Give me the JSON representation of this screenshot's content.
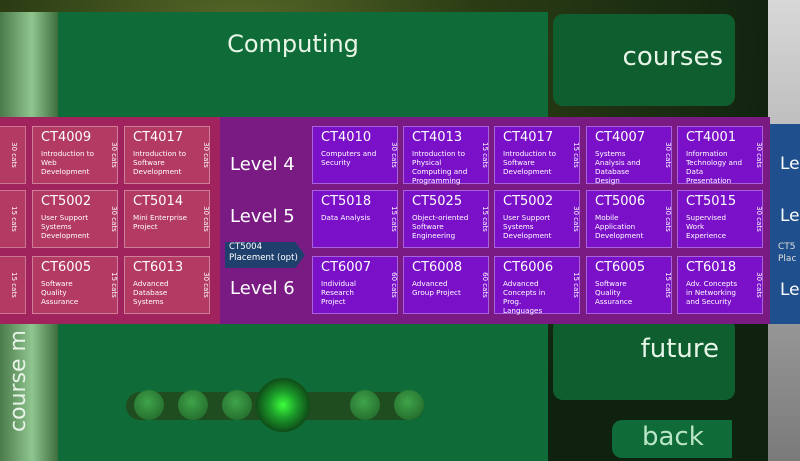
{
  "title": "Computing",
  "side_label": "course m",
  "nav": {
    "courses": "courses",
    "future": "future",
    "back": "back"
  },
  "levels": [
    "Level 4",
    "Level 5",
    "Level 6"
  ],
  "right_peek": {
    "levels": [
      "Le",
      "Le",
      "Le"
    ],
    "placement": [
      "CT5",
      "Plac"
    ]
  },
  "placement": {
    "code": "CT5004",
    "label": "Placement (opt)"
  },
  "left_edge_cats": [
    "30 cats",
    "15 cats",
    "15 cats"
  ],
  "left_modules": [
    [
      {
        "code": "CT4009",
        "name": "Introduction to Web Development",
        "cats": "30 cats"
      },
      {
        "code": "CT4017",
        "name": "Introduction to Software Development",
        "cats": "30 cats"
      }
    ],
    [
      {
        "code": "CT5002",
        "name": "User Support Systems Development",
        "cats": "30 cats"
      },
      {
        "code": "CT5014",
        "name": "Mini Enterprise Project",
        "cats": "30 cats"
      }
    ],
    [
      {
        "code": "CT6005",
        "name": "Software Quality Assurance",
        "cats": "15 cats"
      },
      {
        "code": "CT6013",
        "name": "Advanced Database Systems",
        "cats": "30 cats"
      }
    ]
  ],
  "modules": [
    [
      {
        "code": "CT4010",
        "name": "Computers and Security",
        "cats": "30 cats"
      },
      {
        "code": "CT4013",
        "name": "Introduction to Physical Computing and Programming",
        "cats": "15 cats"
      },
      {
        "code": "CT4017",
        "name": "Introduction to Software Development",
        "cats": "15 cats"
      },
      {
        "code": "CT4007",
        "name": "Systems Analysis and Database Design",
        "cats": "30 cats"
      },
      {
        "code": "CT4001",
        "name": "Information Technology and Data Presentation",
        "cats": "30 cats"
      }
    ],
    [
      {
        "code": "CT5018",
        "name": "Data Analysis",
        "cats": "15 cats"
      },
      {
        "code": "CT5025",
        "name": "Object-oriented Software Engineering",
        "cats": "15 cats"
      },
      {
        "code": "CT5002",
        "name": "User Support Systems Development",
        "cats": "30 cats"
      },
      {
        "code": "CT5006",
        "name": "Mobile Application Development",
        "cats": "30 cats"
      },
      {
        "code": "CT5015",
        "name": "Supervised Work Experience",
        "cats": "30 cats"
      }
    ],
    [
      {
        "code": "CT6007",
        "name": "Individual Research Project",
        "cats": "60 cats"
      },
      {
        "code": "CT6008",
        "name": "Advanced Group Project",
        "cats": "60 cats"
      },
      {
        "code": "CT6006",
        "name": "Advanced Concepts in Prog. Languages",
        "cats": "15 cats"
      },
      {
        "code": "CT6005",
        "name": "Software Quality Assurance",
        "cats": "15 cats"
      },
      {
        "code": "CT6018",
        "name": "Adv. Concepts in Networking and Security",
        "cats": "30 cats"
      }
    ]
  ]
}
